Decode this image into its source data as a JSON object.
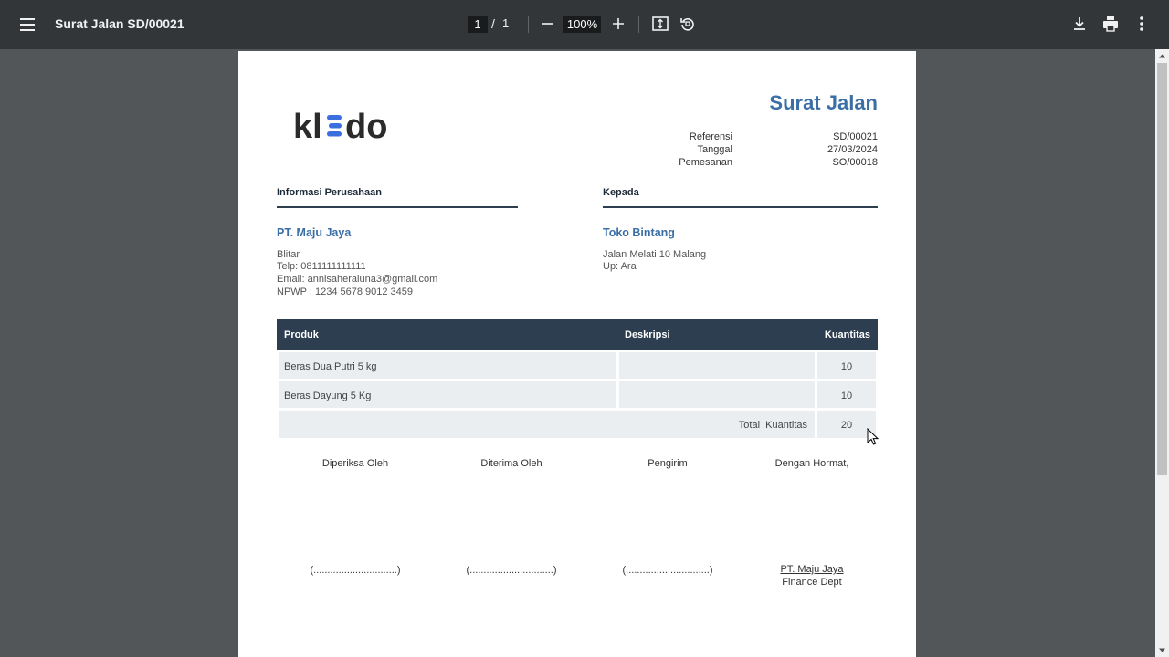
{
  "toolbar": {
    "menu_icon": "hamburger-icon",
    "title": "Surat Jalan SD/00021",
    "page_current": "1",
    "page_sep": "/",
    "page_total": "1",
    "zoom": "100%",
    "icons": [
      "minus-icon",
      "plus-icon",
      "fit-page-icon",
      "rotate-icon",
      "download-icon",
      "print-icon",
      "more-vert-icon"
    ]
  },
  "document": {
    "logo_text": "kledo",
    "heading": "Surat Jalan",
    "meta": [
      {
        "label": "Referensi",
        "value": "SD/00021"
      },
      {
        "label": "Tanggal",
        "value": "27/03/2024"
      },
      {
        "label": "Pemesanan",
        "value": "SO/00018"
      }
    ],
    "from": {
      "section_title": "Informasi Perusahaan",
      "name": "PT. Maju Jaya",
      "lines": [
        "Blitar",
        "Telp: 0811111111111",
        "Email: annisaheraluna3@gmail.com",
        "NPWP : 1234 5678 9012 3459"
      ]
    },
    "to": {
      "section_title": "Kepada",
      "name": "Toko Bintang",
      "lines": [
        "Jalan Melati 10 Malang",
        "Up: Ara"
      ]
    },
    "table": {
      "headers": [
        "Produk",
        "Deskripsi",
        "Kuantitas"
      ],
      "rows": [
        {
          "produk": "Beras Dua Putri 5 kg",
          "deskripsi": "",
          "kuantitas": "10"
        },
        {
          "produk": "Beras Dayung 5 Kg",
          "deskripsi": "",
          "kuantitas": "10"
        }
      ],
      "total_label": "Total  Kuantitas",
      "total_value": "20"
    },
    "signatures": [
      {
        "label": "Diperiksa Oleh",
        "line": "(..............................)"
      },
      {
        "label": "Diterima Oleh",
        "line": "(..............................)"
      },
      {
        "label": "Pengirim",
        "line": "(..............................)"
      },
      {
        "label": "Dengan Hormat,",
        "company": "PT. Maju Jaya",
        "dept": "Finance Dept"
      }
    ]
  },
  "colors": {
    "toolbar_bg": "#323639",
    "viewer_bg": "#525659",
    "accent_blue": "#3a6ea5",
    "table_header": "#2c3e50",
    "table_cell": "#ebeef1",
    "logo_blue": "#3b6fe0"
  }
}
